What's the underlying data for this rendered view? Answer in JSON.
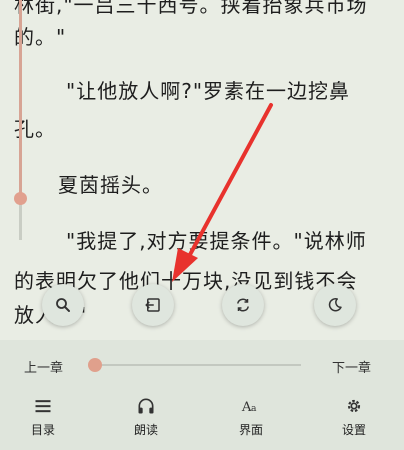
{
  "reader": {
    "lines": [
      "林街,\"一吕三十西号。挟着抬象兵市场",
      "的。\"",
      "\"让他放人啊?\"罗素在一边挖鼻",
      "孔。",
      "夏茵摇头。",
      "\"我提了,对方要提条件。\"说林师",
      "的表明欠了他们十万块,没见到钱不会",
      "放人。\""
    ]
  },
  "quick_actions": {
    "search_icon": "search-icon",
    "exit_icon": "exit-icon",
    "refresh_icon": "refresh-icon",
    "night_icon": "moon-icon"
  },
  "chapter_nav": {
    "prev_label": "上一章",
    "next_label": "下一章",
    "progress": 0.0
  },
  "toolbar": {
    "items": [
      {
        "label": "目录",
        "icon": "list-icon"
      },
      {
        "label": "朗读",
        "icon": "headphones-icon"
      },
      {
        "label": "界面",
        "icon": "font-icon"
      },
      {
        "label": "设置",
        "icon": "gear-icon"
      }
    ]
  },
  "colors": {
    "accent": "#e0a08c",
    "annotation_arrow": "#e8322d",
    "panel_bg": "#dfe5dc",
    "page_bg": "#e9ede4"
  }
}
